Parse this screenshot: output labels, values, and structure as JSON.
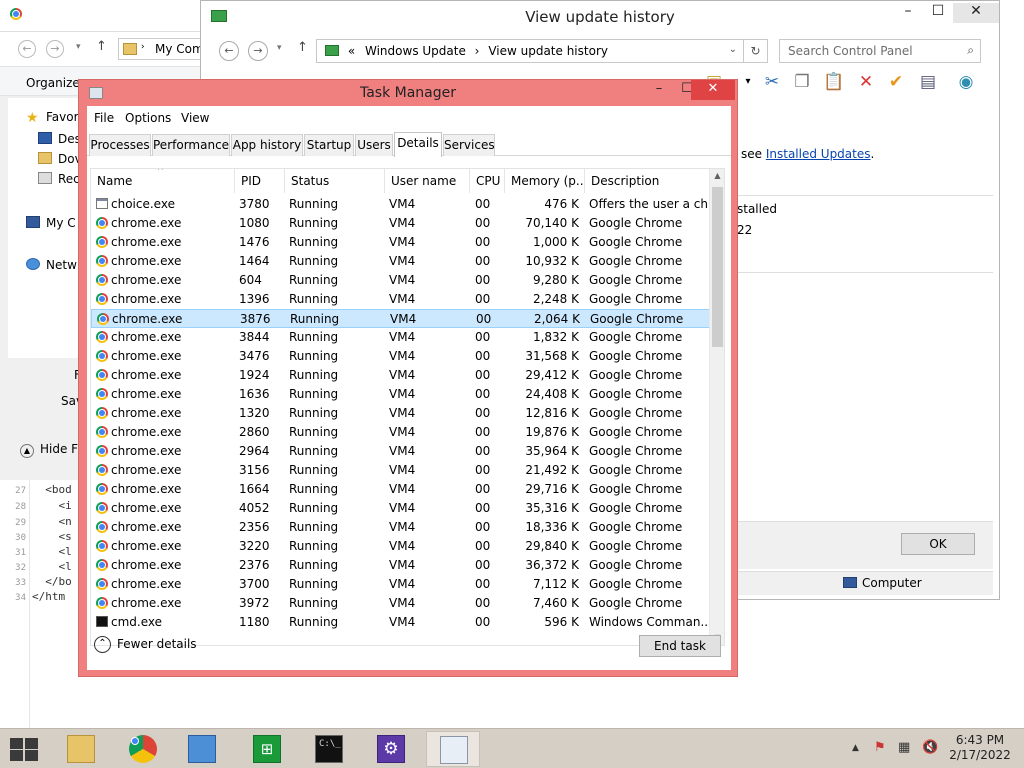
{
  "explorer": {
    "address_text": "My Com",
    "organize_label": "Organize",
    "tree": [
      "Favor",
      "Des",
      "Dov",
      "Rec",
      "My C",
      "Netw"
    ],
    "side_labels": [
      "F",
      "Sav"
    ],
    "hide_folders_label": "Hide Fo"
  },
  "editor": {
    "lines": [
      {
        "num": "27",
        "text": "  <bod"
      },
      {
        "num": "28",
        "text": "    <i"
      },
      {
        "num": "29",
        "text": "    <n"
      },
      {
        "num": "30",
        "text": "    <s"
      },
      {
        "num": "31",
        "text": "    <l"
      },
      {
        "num": "32",
        "text": "    <l"
      },
      {
        "num": "33",
        "text": "  </bo"
      },
      {
        "num": "34",
        "text": "</htm"
      }
    ]
  },
  "update_history": {
    "title": "View update history",
    "breadcrumb": [
      "«",
      "Windows Update",
      "›",
      "View update history"
    ],
    "search_placeholder": "Search Control Panel",
    "content_prefix": "see ",
    "content_link": "Installed Updates",
    "content_suffix": ".",
    "list_header": "stalled",
    "list_value": "22",
    "ok_label": "OK",
    "status_computer": "Computer"
  },
  "task_manager": {
    "title": "Task Manager",
    "menu": [
      "File",
      "Options",
      "View"
    ],
    "tabs": [
      "Processes",
      "Performance",
      "App history",
      "Startup",
      "Users",
      "Details",
      "Services"
    ],
    "active_tab": "Details",
    "columns": [
      "Name",
      "PID",
      "Status",
      "User name",
      "CPU",
      "Memory (p...",
      "Description"
    ],
    "rows": [
      {
        "name": "choice.exe",
        "pid": "3780",
        "status": "Running",
        "user": "VM4",
        "cpu": "00",
        "mem": "476 K",
        "desc": "Offers the user a ch...",
        "icon": "generic"
      },
      {
        "name": "chrome.exe",
        "pid": "1080",
        "status": "Running",
        "user": "VM4",
        "cpu": "00",
        "mem": "70,140 K",
        "desc": "Google Chrome",
        "icon": "chrome"
      },
      {
        "name": "chrome.exe",
        "pid": "1476",
        "status": "Running",
        "user": "VM4",
        "cpu": "00",
        "mem": "1,000 K",
        "desc": "Google Chrome",
        "icon": "chrome"
      },
      {
        "name": "chrome.exe",
        "pid": "1464",
        "status": "Running",
        "user": "VM4",
        "cpu": "00",
        "mem": "10,932 K",
        "desc": "Google Chrome",
        "icon": "chrome"
      },
      {
        "name": "chrome.exe",
        "pid": "604",
        "status": "Running",
        "user": "VM4",
        "cpu": "00",
        "mem": "9,280 K",
        "desc": "Google Chrome",
        "icon": "chrome"
      },
      {
        "name": "chrome.exe",
        "pid": "1396",
        "status": "Running",
        "user": "VM4",
        "cpu": "00",
        "mem": "2,248 K",
        "desc": "Google Chrome",
        "icon": "chrome"
      },
      {
        "name": "chrome.exe",
        "pid": "3876",
        "status": "Running",
        "user": "VM4",
        "cpu": "00",
        "mem": "2,064 K",
        "desc": "Google Chrome",
        "icon": "chrome",
        "selected": true
      },
      {
        "name": "chrome.exe",
        "pid": "3844",
        "status": "Running",
        "user": "VM4",
        "cpu": "00",
        "mem": "1,832 K",
        "desc": "Google Chrome",
        "icon": "chrome"
      },
      {
        "name": "chrome.exe",
        "pid": "3476",
        "status": "Running",
        "user": "VM4",
        "cpu": "00",
        "mem": "31,568 K",
        "desc": "Google Chrome",
        "icon": "chrome"
      },
      {
        "name": "chrome.exe",
        "pid": "1924",
        "status": "Running",
        "user": "VM4",
        "cpu": "00",
        "mem": "29,412 K",
        "desc": "Google Chrome",
        "icon": "chrome"
      },
      {
        "name": "chrome.exe",
        "pid": "1636",
        "status": "Running",
        "user": "VM4",
        "cpu": "00",
        "mem": "24,408 K",
        "desc": "Google Chrome",
        "icon": "chrome"
      },
      {
        "name": "chrome.exe",
        "pid": "1320",
        "status": "Running",
        "user": "VM4",
        "cpu": "00",
        "mem": "12,816 K",
        "desc": "Google Chrome",
        "icon": "chrome"
      },
      {
        "name": "chrome.exe",
        "pid": "2860",
        "status": "Running",
        "user": "VM4",
        "cpu": "00",
        "mem": "19,876 K",
        "desc": "Google Chrome",
        "icon": "chrome"
      },
      {
        "name": "chrome.exe",
        "pid": "2964",
        "status": "Running",
        "user": "VM4",
        "cpu": "00",
        "mem": "35,964 K",
        "desc": "Google Chrome",
        "icon": "chrome"
      },
      {
        "name": "chrome.exe",
        "pid": "3156",
        "status": "Running",
        "user": "VM4",
        "cpu": "00",
        "mem": "21,492 K",
        "desc": "Google Chrome",
        "icon": "chrome"
      },
      {
        "name": "chrome.exe",
        "pid": "1664",
        "status": "Running",
        "user": "VM4",
        "cpu": "00",
        "mem": "29,716 K",
        "desc": "Google Chrome",
        "icon": "chrome"
      },
      {
        "name": "chrome.exe",
        "pid": "4052",
        "status": "Running",
        "user": "VM4",
        "cpu": "00",
        "mem": "35,316 K",
        "desc": "Google Chrome",
        "icon": "chrome"
      },
      {
        "name": "chrome.exe",
        "pid": "2356",
        "status": "Running",
        "user": "VM4",
        "cpu": "00",
        "mem": "18,336 K",
        "desc": "Google Chrome",
        "icon": "chrome"
      },
      {
        "name": "chrome.exe",
        "pid": "3220",
        "status": "Running",
        "user": "VM4",
        "cpu": "00",
        "mem": "29,840 K",
        "desc": "Google Chrome",
        "icon": "chrome"
      },
      {
        "name": "chrome.exe",
        "pid": "2376",
        "status": "Running",
        "user": "VM4",
        "cpu": "00",
        "mem": "36,372 K",
        "desc": "Google Chrome",
        "icon": "chrome"
      },
      {
        "name": "chrome.exe",
        "pid": "3700",
        "status": "Running",
        "user": "VM4",
        "cpu": "00",
        "mem": "7,112 K",
        "desc": "Google Chrome",
        "icon": "chrome"
      },
      {
        "name": "chrome.exe",
        "pid": "3972",
        "status": "Running",
        "user": "VM4",
        "cpu": "00",
        "mem": "7,460 K",
        "desc": "Google Chrome",
        "icon": "chrome"
      },
      {
        "name": "cmd.exe",
        "pid": "1180",
        "status": "Running",
        "user": "VM4",
        "cpu": "00",
        "mem": "596 K",
        "desc": "Windows Comman...",
        "icon": "cmd"
      }
    ],
    "fewer_details_label": "Fewer details",
    "end_task_label": "End task",
    "accent_color": "#f08080"
  },
  "taskbar": {
    "apps": [
      "file-explorer",
      "chrome",
      "control-panel",
      "store",
      "command-prompt",
      "settings",
      "task-manager"
    ],
    "active_app": "task-manager",
    "clock_time": "6:43 PM",
    "clock_date": "2/17/2022"
  }
}
